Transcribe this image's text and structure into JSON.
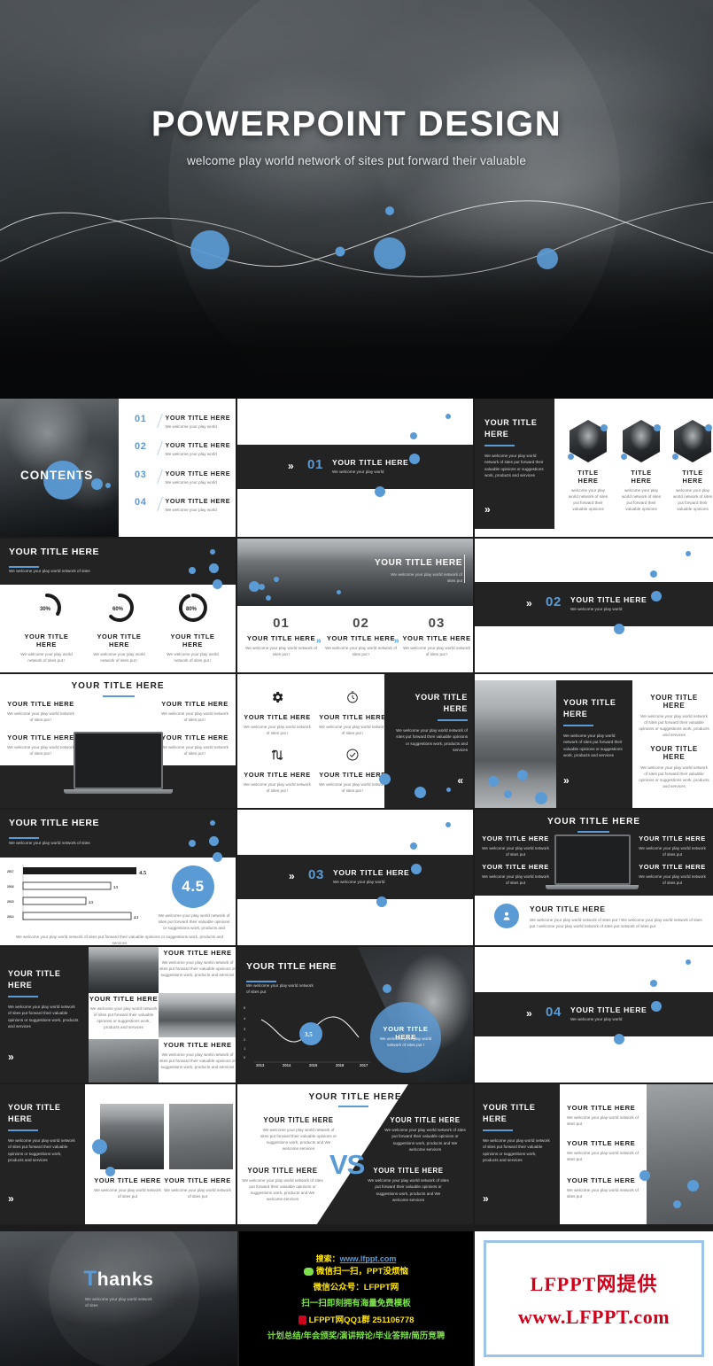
{
  "cover": {
    "title": "POWERPOINT DESIGN",
    "subtitle": "welcome play world network of sites put forward their valuable"
  },
  "common": {
    "title": "YOUR TITLE HERE",
    "title_short": "TITLE HERE",
    "desc_short": "We welcome your play world",
    "desc_sites": "We welcome your play world network of sites",
    "desc_put": "We welcome your play world network of sites put !",
    "desc_put2": "We welcome your play world network of sites put",
    "desc_long": "We welcome your play world network of sites put forward their valuable opinions or suggestions work, products and services",
    "desc_long2": "We welcome your play world network of sites put forward their valuable opinions or suggestions work, products and We welcome services",
    "desc_card": "welcome your play world network of sites put forward their valuable opinions",
    "chevron_right": "»",
    "chevron_left": "«",
    "vs": "VS"
  },
  "contents": {
    "label": "CONTENTS",
    "items": [
      {
        "num": "01",
        "title": "YOUR TITLE HERE",
        "desc": "We welcome your play world"
      },
      {
        "num": "02",
        "title": "YOUR TITLE HERE",
        "desc": "We welcome your play world"
      },
      {
        "num": "03",
        "title": "YOUR TITLE HERE",
        "desc": "We welcome your play world"
      },
      {
        "num": "04",
        "title": "YOUR TITLE HERE",
        "desc": "We welcome your play world"
      }
    ]
  },
  "section_dividers": [
    {
      "num": "01",
      "title": "YOUR TITLE HERE",
      "desc": "We welcome your play world"
    },
    {
      "num": "02",
      "title": "YOUR TITLE HERE",
      "desc": "We welcome your play world"
    },
    {
      "num": "03",
      "title": "YOUR TITLE HERE",
      "desc": "We welcome your play world"
    },
    {
      "num": "04",
      "title": "YOUR TITLE HERE",
      "desc": "We welcome your play world"
    }
  ],
  "team_slide": {
    "title": "YOUR TITLE HERE",
    "desc": "We welcome your play world network of sites put forward their valuable opinions or suggestions work, products and services",
    "members": [
      {
        "name": "TITLE HERE",
        "desc": "welcome your play world network of sites put forward their valuable opinions"
      },
      {
        "name": "TITLE HERE",
        "desc": "welcome your play world network of sites put forward their valuable opinions"
      },
      {
        "name": "TITLE HERE",
        "desc": "welcome your play world network of sites put forward their valuable opinions"
      }
    ]
  },
  "donut_slide": {
    "title": "YOUR TITLE HERE",
    "subtitle": "We welcome your play world network of sites",
    "items": [
      {
        "percent": "30%",
        "title": "YOUR TITLE HERE",
        "desc": "We welcome your play world network of sites put !"
      },
      {
        "percent": "60%",
        "title": "YOUR TITLE HERE",
        "desc": "We welcome your play world network of sites put !"
      },
      {
        "percent": "80%",
        "title": "YOUR TITLE HERE",
        "desc": "We welcome your play world network of sites put !"
      }
    ]
  },
  "steps_slide": {
    "hero_title": "YOUR TITLE HERE",
    "hero_desc": "We welcome your play world network of sites put",
    "steps": [
      {
        "num": "01",
        "title": "YOUR TITLE HERE",
        "desc": "We welcome your play world network of sites put !"
      },
      {
        "num": "02",
        "title": "YOUR TITLE HERE",
        "desc": "We welcome your play world network of sites put !"
      },
      {
        "num": "03",
        "title": "YOUR TITLE HERE",
        "desc": "We welcome your play world network of sites put !"
      }
    ]
  },
  "laptop_slide_light": {
    "title": "YOUR TITLE HERE",
    "items": [
      {
        "title": "YOUR TITLE HERE",
        "desc": "We welcome your play world network of sites put !"
      },
      {
        "title": "YOUR TITLE HERE",
        "desc": "We welcome your play world network of sites put !"
      },
      {
        "title": "YOUR TITLE HERE",
        "desc": "We welcome your play world network of sites put !"
      },
      {
        "title": "YOUR TITLE HERE",
        "desc": "We welcome your play world network of sites put !"
      }
    ]
  },
  "icons_slide": {
    "items": [
      {
        "icon": "gear-icon",
        "title": "YOUR TITLE HERE",
        "desc": "We welcome your play world network of sites put !"
      },
      {
        "icon": "stopwatch-icon",
        "title": "YOUR TITLE HERE",
        "desc": "We welcome your play world network of sites put !"
      },
      {
        "icon": "arrows-loop-icon",
        "title": "YOUR TITLE HERE",
        "desc": "We welcome your play world network of sites put !"
      },
      {
        "icon": "check-circle-icon",
        "title": "YOUR TITLE HERE",
        "desc": "We welcome your play world network of sites put !"
      }
    ],
    "panel_title": "YOUR TITLE HERE",
    "panel_desc": "We welcome your play world network of sites put forward their valuable opinions or suggestions work, products and services"
  },
  "photo_panel_slide": {
    "title": "YOUR TITLE HERE",
    "desc": "We welcome your play world network of sites put forward their valuable opinions or suggestions work, products and services",
    "right_items": [
      {
        "title": "YOUR TITLE HERE",
        "desc": "We welcome your play world network of sites put forward their valuable opinions or suggestions work, products and services"
      },
      {
        "title": "YOUR TITLE HERE",
        "desc": "We welcome your play world network of sites put forward their valuable opinions or suggestions work, products and services"
      }
    ]
  },
  "bar_slide": {
    "title": "YOUR TITLE HERE",
    "subtitle": "We welcome your play world network of sites",
    "score": "4.5",
    "score_desc": "We welcome your play world network of sites put forward their valuable opinions or suggestions work, products and",
    "footer": "We welcome your play world network of sites put forward their valuable opinions or suggestions work, products and services"
  },
  "laptop_slide_dark": {
    "title": "YOUR TITLE HERE",
    "items": [
      {
        "title": "YOUR TITLE HERE",
        "desc": "We welcome your play world network of sites put"
      },
      {
        "title": "YOUR TITLE HERE",
        "desc": "We welcome your play world network of sites put"
      },
      {
        "title": "YOUR TITLE HERE",
        "desc": "We welcome your play world network of sites put"
      },
      {
        "title": "YOUR TITLE HERE",
        "desc": "We welcome your play world network of sites put"
      }
    ],
    "banner_title": "YOUR TITLE HERE",
    "banner_desc": "We welcome your play world network of sites put ! We welcome your play world network of sites put ! welcome your play world network of sites put network of sites put"
  },
  "mosaic_slide": {
    "title": "YOUR TITLE HERE",
    "desc": "We welcome your play world network of sites put forward their valuable opinions or suggestions work, products and services",
    "cards": [
      {
        "title": "YOUR TITLE HERE",
        "desc": "We welcome your play world network of sites put forward their valuable opinions or suggestions work, products and services"
      },
      {
        "title": "YOUR TITLE HERE",
        "desc": "We welcome your play world network of sites put forward their valuable opinions or suggestions work, products and services"
      },
      {
        "title": "YOUR TITLE HERE",
        "desc": "We welcome your play world network of sites put forward their valuable opinions or suggestions work, products and services"
      }
    ]
  },
  "line_slide": {
    "title": "YOUR TITLE HERE",
    "subtitle": "We welcome your play world network of sites put",
    "marker": "3.5",
    "overlay_title": "YOUR TITLE HERE",
    "overlay_desc": "We welcome your play world network of sites put !"
  },
  "vs_slide": {
    "title": "YOUR TITLE HERE",
    "vs": "VS",
    "quadrants": [
      {
        "title": "YOUR TITLE HERE",
        "desc": "We welcome your play world network of sites put forward their valuable opinions or suggestions work, products and We welcome services"
      },
      {
        "title": "YOUR TITLE HERE",
        "desc": "We welcome your play world network of sites put forward their valuable opinions or suggestions work, products and We welcome services"
      },
      {
        "title": "YOUR TITLE HERE",
        "desc": "We welcome your play world network of sites put forward their valuable opinions or suggestions work, products and We welcome services"
      },
      {
        "title": "YOUR TITLE HERE",
        "desc": "We welcome your play world network of sites put forward their valuable opinions or suggestions work, products and We welcome services"
      }
    ]
  },
  "list_photo_slide": {
    "title": "YOUR TITLE HERE",
    "desc": "We welcome your play world network of sites put forward their valuable opinions or suggestions work, products and services",
    "items": [
      {
        "title": "YOUR TITLE HERE",
        "desc": "We welcome your play world network of sites put"
      },
      {
        "title": "YOUR TITLE HERE",
        "desc": "We welcome your play world network of sites put"
      },
      {
        "title": "YOUR TITLE HERE",
        "desc": "We welcome your play world network of sites put"
      }
    ]
  },
  "thanks": {
    "title_accent": "T",
    "title_rest": "hanks",
    "desc": "We welcome your play world network of sites"
  },
  "promo": {
    "search_prefix": "搜索：",
    "search_url": "www.lfppt.com",
    "line_wechat": "微信扫一扫，PPT没烦恼",
    "line_account": "微信公众号：LFPPT网",
    "line_scan": "扫一扫即刻拥有海量免费模板",
    "line_qq": "LFPPT网QQ1群 251106778",
    "line_tags": "计划总结/年会颁奖/演讲辩论/毕业答辩/简历竞聘",
    "brand_line1": "LFPPT网提供",
    "brand_line2": "www.LFPPT.com"
  },
  "chart_data": [
    {
      "type": "bar",
      "orientation": "horizontal",
      "title": "YOUR TITLE HERE",
      "categories": [
        "2017",
        "2016",
        "2015",
        "2014"
      ],
      "values": [
        4.5,
        3.5,
        2.5,
        4.3
      ],
      "data_labels": [
        "4.5",
        "3.5",
        "2.5",
        "4.3"
      ],
      "xlabel": "",
      "ylabel": "",
      "xlim": [
        0,
        5
      ],
      "grid": false,
      "legend": "none",
      "highlight_index": 0,
      "kpi": "4.5"
    },
    {
      "type": "line",
      "title": "YOUR TITLE HERE",
      "x": [
        "2013",
        "2014",
        "2015",
        "2016",
        "2017"
      ],
      "values": [
        4.0,
        2.4,
        2.1,
        4.4,
        2.3
      ],
      "yticks": [
        "0",
        "1",
        "2",
        "3",
        "4",
        "5"
      ],
      "ylim": [
        0,
        5
      ],
      "grid": false,
      "legend": "none",
      "annotation": "3.5"
    },
    {
      "type": "pie",
      "subtype": "donut-set",
      "title": "YOUR TITLE HERE",
      "categories": [
        "YOUR TITLE HERE",
        "YOUR TITLE HERE",
        "YOUR TITLE HERE"
      ],
      "values": [
        30,
        60,
        80
      ],
      "data_labels": [
        "30%",
        "60%",
        "80%"
      ],
      "ylim": [
        0,
        100
      ],
      "legend": "none"
    }
  ]
}
